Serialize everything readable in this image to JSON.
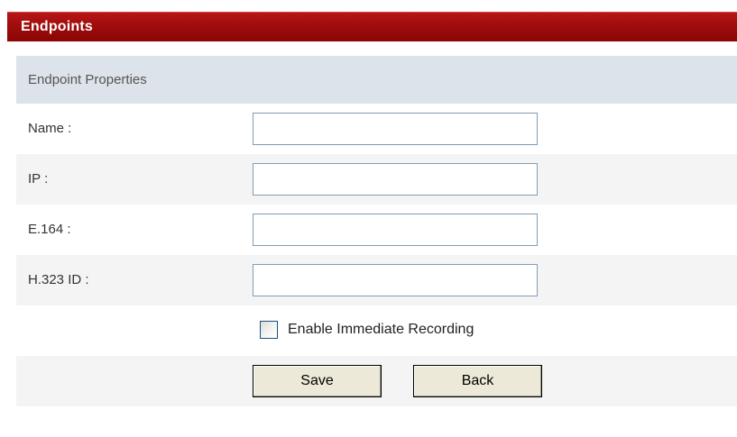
{
  "window": {
    "title": "Endpoints"
  },
  "section": {
    "title": "Endpoint Properties"
  },
  "form": {
    "fields": [
      {
        "label": "Name :",
        "value": ""
      },
      {
        "label": "IP :",
        "value": ""
      },
      {
        "label": "E.164 :",
        "value": ""
      },
      {
        "label": "H.323 ID :",
        "value": ""
      }
    ],
    "immediate_recording": {
      "label": "Enable Immediate Recording",
      "checked": false
    },
    "buttons": {
      "save_label": "Save",
      "back_label": "Back"
    }
  },
  "colors": {
    "title_bar": "#a00c0c",
    "section_header": "#dde3ea",
    "alt_row": "#f4f4f4",
    "button_face": "#ece9d8",
    "input_border": "#7f9db9"
  }
}
